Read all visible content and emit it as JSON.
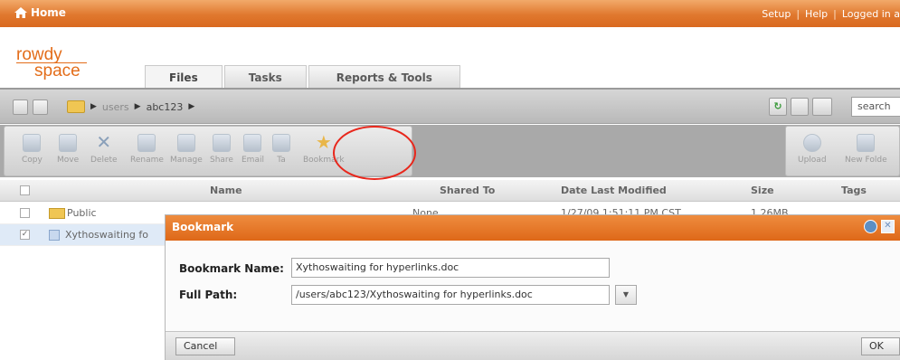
{
  "topbar": {
    "home": "Home",
    "links": [
      "Setup",
      "Help",
      "Logged in a"
    ]
  },
  "logo": {
    "line1": "rowdy",
    "line2": "space"
  },
  "tabs": [
    "Files",
    "Tasks",
    "Reports & Tools"
  ],
  "pathbar": {
    "crumbs": [
      "users",
      "abc123"
    ],
    "search": "search"
  },
  "toolbar": {
    "buttons": [
      "Copy",
      "Move",
      "Delete",
      "Rename",
      "Manage",
      "Share",
      "Email",
      "Ta",
      "Bookmark"
    ],
    "right_buttons": [
      "Upload",
      "New Folde"
    ]
  },
  "list": {
    "columns": [
      "Name",
      "Shared To",
      "Date Last Modified",
      "Size",
      "Tags"
    ],
    "rows": [
      {
        "name": "Public",
        "shared": "None",
        "date": "1/27/09 1:51:11 PM CST",
        "size": "1.26MB"
      },
      {
        "name": "Xythoswaiting fo"
      }
    ]
  },
  "dialog": {
    "title": "Bookmark",
    "name_label": "Bookmark Name:",
    "name_value": "Xythoswaiting for hyperlinks.doc",
    "path_label": "Full Path:",
    "path_value": "/users/abc123/Xythoswaiting for hyperlinks.doc",
    "cancel": "Cancel",
    "ok": "OK"
  },
  "colors": {
    "topbar": "#e0782e",
    "dialog_title": "#de6818",
    "annotation_circle": "#e8271c"
  }
}
